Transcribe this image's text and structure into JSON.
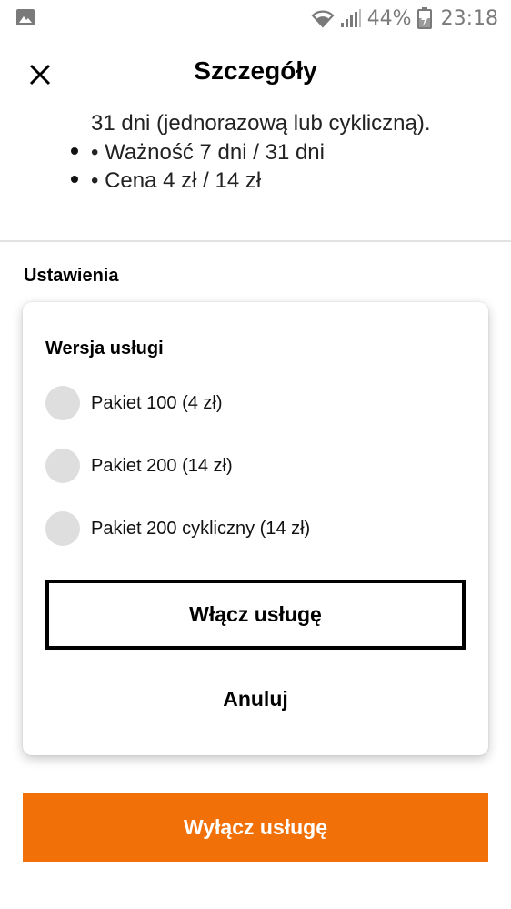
{
  "status_bar": {
    "battery": "44%",
    "time": "23:18",
    "icons": [
      "image-icon",
      "wifi-icon",
      "signal-icon",
      "battery-charging-icon"
    ]
  },
  "header": {
    "title": "Szczegóły",
    "close_icon": "close-icon"
  },
  "description": {
    "continuation": "31 dni (jednorazową lub cykliczną).",
    "bullets": [
      "• Ważność 7 dni / 31 dni",
      "• Cena 4 zł / 14 zł"
    ]
  },
  "settings": {
    "section_label": "Ustawienia",
    "card_title": "Wersja usługi",
    "options": [
      {
        "label": "Pakiet 100 (4 zł)",
        "selected": false
      },
      {
        "label": "Pakiet 200 (14 zł)",
        "selected": false
      },
      {
        "label": "Pakiet 200 cykliczny (14 zł)",
        "selected": false
      }
    ],
    "enable_label": "Włącz usługę",
    "cancel_label": "Anuluj"
  },
  "footer": {
    "disable_label": "Wyłącz usługę",
    "accent_color": "#f27008"
  }
}
